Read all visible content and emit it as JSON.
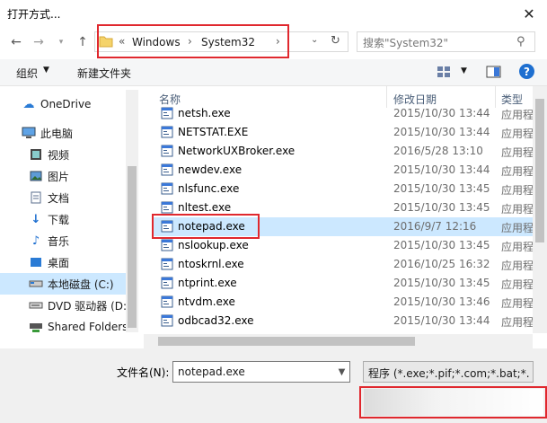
{
  "window": {
    "title": "打开方式..."
  },
  "nav": {
    "breadcrumb": [
      "Windows",
      "System32"
    ],
    "search_placeholder": "搜索\"System32\""
  },
  "toolbar": {
    "organize": "组织",
    "new_folder": "新建文件夹"
  },
  "sidebar": {
    "items": [
      {
        "label": "OneDrive",
        "icon": "cloud-icon"
      },
      {
        "label": "此电脑",
        "icon": "computer-icon"
      },
      {
        "label": "视频",
        "icon": "video-icon"
      },
      {
        "label": "图片",
        "icon": "picture-icon"
      },
      {
        "label": "文档",
        "icon": "document-icon"
      },
      {
        "label": "下载",
        "icon": "download-icon"
      },
      {
        "label": "音乐",
        "icon": "music-icon"
      },
      {
        "label": "桌面",
        "icon": "desktop-icon"
      },
      {
        "label": "本地磁盘 (C:)",
        "icon": "drive-icon"
      },
      {
        "label": "DVD 驱动器 (D:",
        "icon": "dvd-icon"
      },
      {
        "label": "Shared Folders",
        "icon": "shared-folder-icon"
      }
    ]
  },
  "columns": {
    "name": "名称",
    "date": "修改日期",
    "type": "类型"
  },
  "files": [
    {
      "name": "netsh.exe",
      "date": "2015/10/30 13:44",
      "type": "应用程"
    },
    {
      "name": "NETSTAT.EXE",
      "date": "2015/10/30 13:44",
      "type": "应用程"
    },
    {
      "name": "NetworkUXBroker.exe",
      "date": "2016/5/28 13:10",
      "type": "应用程"
    },
    {
      "name": "newdev.exe",
      "date": "2015/10/30 13:44",
      "type": "应用程"
    },
    {
      "name": "nlsfunc.exe",
      "date": "2015/10/30 13:45",
      "type": "应用程"
    },
    {
      "name": "nltest.exe",
      "date": "2015/10/30 13:45",
      "type": "应用程"
    },
    {
      "name": "notepad.exe",
      "date": "2016/9/7 12:16",
      "type": "应用程"
    },
    {
      "name": "nslookup.exe",
      "date": "2015/10/30 13:45",
      "type": "应用程"
    },
    {
      "name": "ntoskrnl.exe",
      "date": "2016/10/25 16:32",
      "type": "应用程"
    },
    {
      "name": "ntprint.exe",
      "date": "2015/10/30 13:45",
      "type": "应用程"
    },
    {
      "name": "ntvdm.exe",
      "date": "2015/10/30 13:46",
      "type": "应用程"
    },
    {
      "name": "odbcad32.exe",
      "date": "2015/10/30 13:44",
      "type": "应用程"
    }
  ],
  "bottom": {
    "filename_label": "文件名(N):",
    "filename_value": "notepad.exe",
    "filetype_value": "程序 (*.exe;*.pif;*.com;*.bat;*."
  }
}
